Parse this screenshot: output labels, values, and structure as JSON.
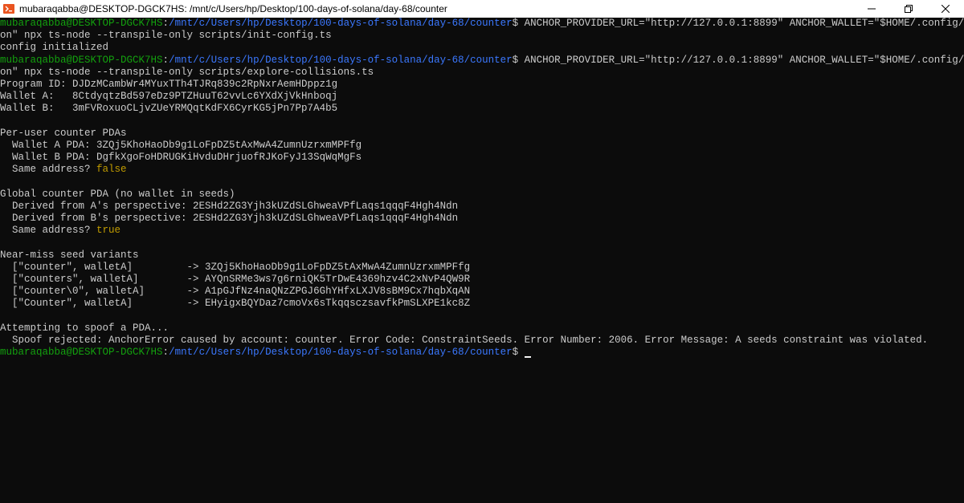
{
  "window": {
    "title": "mubaraqabba@DESKTOP-DGCK7HS: /mnt/c/Users/hp/Desktop/100-days-of-solana/day-68/counter",
    "icon": "ubuntu-terminal-icon",
    "controls": [
      "minimize-icon",
      "restore-icon",
      "close-icon"
    ]
  },
  "colors": {
    "background": "#0c0c0c",
    "text": "#cccccc",
    "prompt_user": "#13a10e",
    "prompt_path": "#3b78ff",
    "value_highlight": "#c19c00"
  },
  "terminal": {
    "lines": [
      [
        {
          "t": "mubaraqabba@DESKTOP-DGCK7HS",
          "c": "green"
        },
        {
          "t": ":",
          "c": "default"
        },
        {
          "t": "/mnt/c/Users/hp/Desktop/100-days-of-solana/day-68/counter",
          "c": "blue"
        },
        {
          "t": "$ ANCHOR_PROVIDER_URL=\"http://127.0.0.1:8899\" ANCHOR_WALLET=\"$HOME/.config/solana/id.js",
          "c": "default"
        }
      ],
      [
        {
          "t": "on\" npx ts-node --transpile-only scripts/init-config.ts",
          "c": "default"
        }
      ],
      [
        {
          "t": "config initialized",
          "c": "default"
        }
      ],
      [
        {
          "t": "mubaraqabba@DESKTOP-DGCK7HS",
          "c": "green"
        },
        {
          "t": ":",
          "c": "default"
        },
        {
          "t": "/mnt/c/Users/hp/Desktop/100-days-of-solana/day-68/counter",
          "c": "blue"
        },
        {
          "t": "$ ANCHOR_PROVIDER_URL=\"http://127.0.0.1:8899\" ANCHOR_WALLET=\"$HOME/.config/solana/id.js",
          "c": "default"
        }
      ],
      [
        {
          "t": "on\" npx ts-node --transpile-only scripts/explore-collisions.ts",
          "c": "default"
        }
      ],
      [
        {
          "t": "Program ID: DJDzMCambWr4MYuxTTh4TJRq839c2RpNxrAemHDppz1g",
          "c": "default"
        }
      ],
      [
        {
          "t": "Wallet A:   8CtdyqtzBd597eDz9PTZHuuT62vvLc6YXdXjVkHnboqj",
          "c": "default"
        }
      ],
      [
        {
          "t": "Wallet B:   3mFVRoxuoCLjvZUeYRMQqtKdFX6CyrKG5jPn7Pp7A4b5",
          "c": "default"
        }
      ],
      [
        {
          "t": "",
          "c": "default"
        }
      ],
      [
        {
          "t": "Per-user counter PDAs",
          "c": "default"
        }
      ],
      [
        {
          "t": "  Wallet A PDA: 3ZQj5KhoHaoDb9g1LoFpDZ5tAxMwA4ZumnUzrxmMPFfg",
          "c": "default"
        }
      ],
      [
        {
          "t": "  Wallet B PDA: DgfkXgoFoHDRUGKiHvduDHrjuofRJKoFyJ13SqWqMgFs",
          "c": "default"
        }
      ],
      [
        {
          "t": "  Same address? ",
          "c": "default"
        },
        {
          "t": "false",
          "c": "yellow"
        }
      ],
      [
        {
          "t": "",
          "c": "default"
        }
      ],
      [
        {
          "t": "Global counter PDA (no wallet in seeds)",
          "c": "default"
        }
      ],
      [
        {
          "t": "  Derived from A's perspective: 2ESHd2ZG3Yjh3kUZdSLGhweaVPfLaqs1qqqF4Hgh4Ndn",
          "c": "default"
        }
      ],
      [
        {
          "t": "  Derived from B's perspective: 2ESHd2ZG3Yjh3kUZdSLGhweaVPfLaqs1qqqF4Hgh4Ndn",
          "c": "default"
        }
      ],
      [
        {
          "t": "  Same address? ",
          "c": "default"
        },
        {
          "t": "true",
          "c": "yellow"
        }
      ],
      [
        {
          "t": "",
          "c": "default"
        }
      ],
      [
        {
          "t": "Near-miss seed variants",
          "c": "default"
        }
      ],
      [
        {
          "t": "  [\"counter\", walletA]         -> 3ZQj5KhoHaoDb9g1LoFpDZ5tAxMwA4ZumnUzrxmMPFfg",
          "c": "default"
        }
      ],
      [
        {
          "t": "  [\"counters\", walletA]        -> AYQnSRMe3ws7g6rniQK5TrDwE4369hzv4C2xNvP4QW9R",
          "c": "default"
        }
      ],
      [
        {
          "t": "  [\"counter\\0\", walletA]       -> A1pGJfNz4naQNzZPGJ6GhYHfxLXJV8sBM9Cx7hqbXqAN",
          "c": "default"
        }
      ],
      [
        {
          "t": "  [\"Counter\", walletA]         -> EHyigxBQYDaz7cmoVx6sTkqqsczsavfkPmSLXPE1kc8Z",
          "c": "default"
        }
      ],
      [
        {
          "t": "",
          "c": "default"
        }
      ],
      [
        {
          "t": "Attempting to spoof a PDA...",
          "c": "default"
        }
      ],
      [
        {
          "t": "  Spoof rejected: AnchorError caused by account: counter. Error Code: ConstraintSeeds. Error Number: 2006. Error Message: A seeds constraint was violated.",
          "c": "default"
        }
      ],
      [
        {
          "t": "mubaraqabba@DESKTOP-DGCK7HS",
          "c": "green"
        },
        {
          "t": ":",
          "c": "default"
        },
        {
          "t": "/mnt/c/Users/hp/Desktop/100-days-of-solana/day-68/counter",
          "c": "blue"
        },
        {
          "t": "$ ",
          "c": "default"
        }
      ]
    ],
    "cursor_visible": true
  }
}
